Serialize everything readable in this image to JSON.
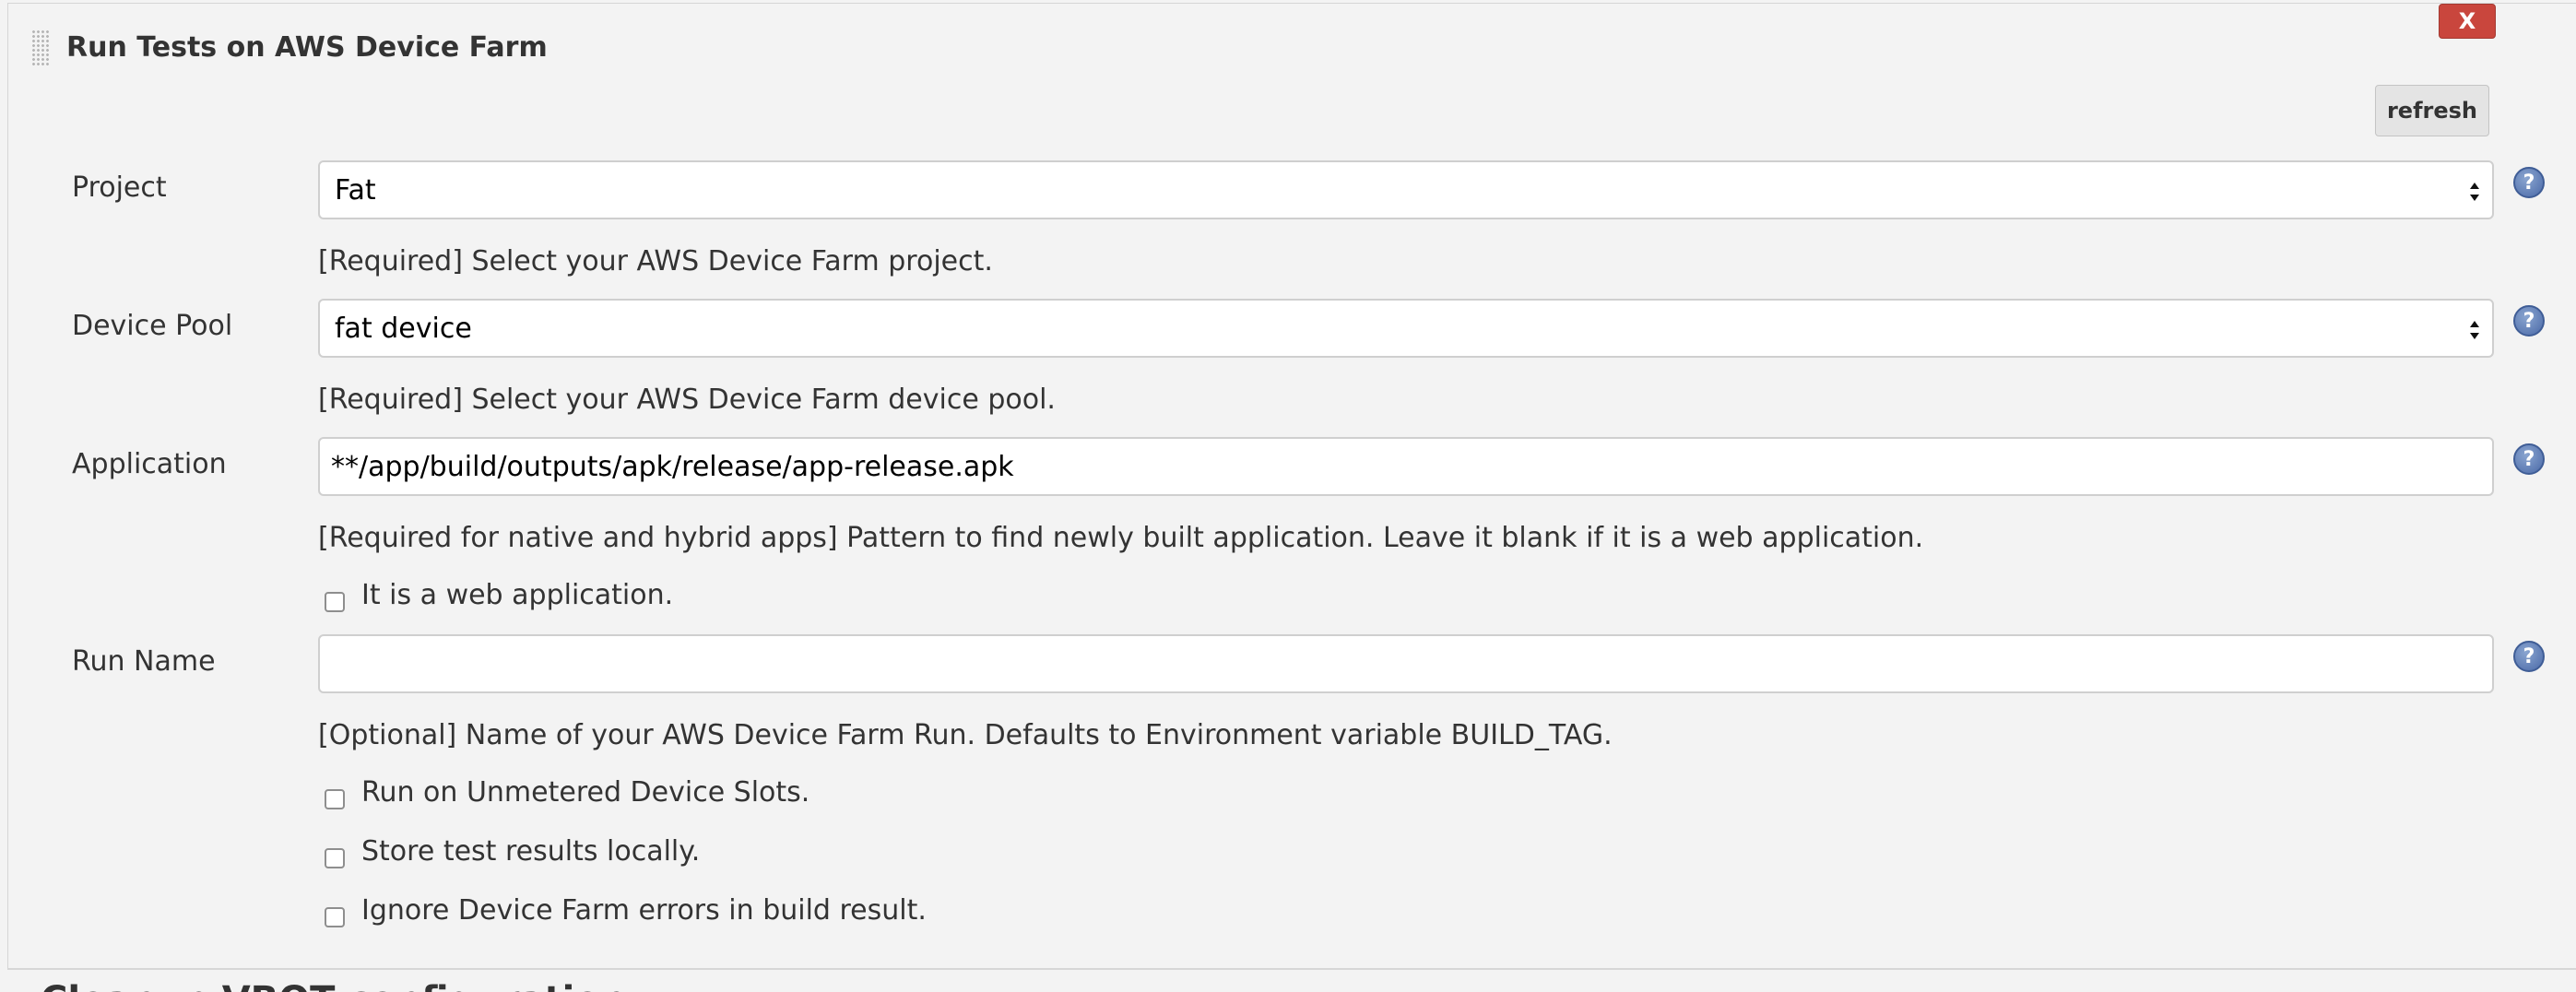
{
  "section": {
    "title": "Run Tests on AWS Device Farm",
    "delete_label": "X",
    "refresh_label": "refresh"
  },
  "fields": {
    "project": {
      "label": "Project",
      "value": "Fat",
      "help": "[Required] Select your AWS Device Farm project."
    },
    "device_pool": {
      "label": "Device Pool",
      "value": "fat device",
      "help": "[Required] Select your AWS Device Farm device pool."
    },
    "application": {
      "label": "Application",
      "value": "**/app/build/outputs/apk/release/app-release.apk",
      "help": "[Required for native and hybrid apps] Pattern to find newly built application. Leave it blank if it is a web application."
    },
    "web_app_checkbox": {
      "label": "It is a web application.",
      "checked": false
    },
    "run_name": {
      "label": "Run Name",
      "value": "",
      "help": "[Optional] Name of your AWS Device Farm Run. Defaults to Environment variable BUILD_TAG."
    }
  },
  "checkboxes": [
    {
      "label": "Run on Unmetered Device Slots.",
      "checked": false
    },
    {
      "label": "Store test results locally.",
      "checked": false
    },
    {
      "label": "Ignore Device Farm errors in build result.",
      "checked": false
    }
  ],
  "help_icon_glyph": "?",
  "next_section_title": "Cleanup VBOT configuration",
  "colors": {
    "background": "#f3f3f3",
    "delete_button": "#c9463d",
    "help_icon": "#4b6aa8",
    "text": "#333333"
  }
}
